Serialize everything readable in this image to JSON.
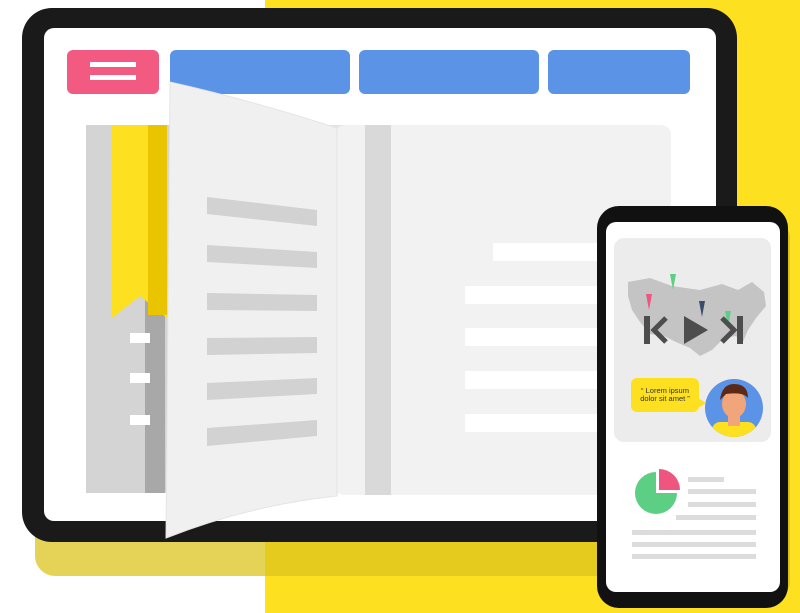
{
  "illustration": {
    "colors": {
      "accent_yellow": "#fde01f",
      "frame_black": "#111111",
      "menu_pink": "#f25a82",
      "tab_blue": "#5b93e6",
      "paper": "#f2f2f2",
      "pie_green": "#5ccf85",
      "pie_pink": "#ee5680"
    },
    "tablet": {
      "menu_icon": "hamburger-icon",
      "nav_tabs": 3
    },
    "phone": {
      "quote_text": "“ Lorem ipsum dolor sit amet ”",
      "media_controls": [
        "skip-back-icon",
        "play-icon",
        "skip-forward-icon"
      ],
      "map": "usa-map"
    }
  }
}
